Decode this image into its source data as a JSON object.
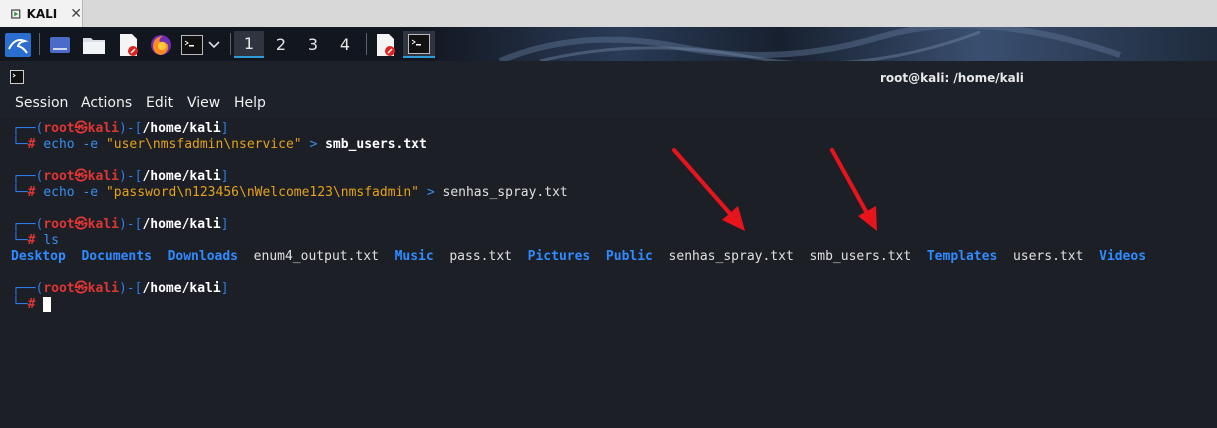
{
  "vm_tab": {
    "label": "KALI",
    "close": "✕"
  },
  "panel": {
    "workspaces": [
      "1",
      "2",
      "3",
      "4"
    ],
    "active_workspace": "1"
  },
  "window": {
    "title": "root@kali: /home/kali"
  },
  "menu": [
    "Session",
    "Actions",
    "Edit",
    "View",
    "Help"
  ],
  "prompt": {
    "open": "┌──(",
    "user": "root",
    "at": "㉿",
    "host": "kali",
    "mid": ")-[",
    "path": "/home/kali",
    "close": "]",
    "lower": "└─",
    "hash": "#"
  },
  "commands": [
    {
      "cmd": "echo",
      "flag": "-e",
      "arg": "\"user\\nmsfadmin\\nservice\"",
      "redir": ">",
      "file": "smb_users.txt"
    },
    {
      "cmd": "echo",
      "flag": "-e",
      "arg": "\"password\\n123456\\nWelcome123\\nmsfadmin\"",
      "redir": ">",
      "file": "senhas_spray.txt"
    },
    {
      "cmd": "ls"
    }
  ],
  "ls_output": [
    {
      "name": "Desktop",
      "dir": true
    },
    {
      "name": "Documents",
      "dir": true
    },
    {
      "name": "Downloads",
      "dir": true
    },
    {
      "name": "enum4_output.txt",
      "dir": false
    },
    {
      "name": "Music",
      "dir": true
    },
    {
      "name": "pass.txt",
      "dir": false
    },
    {
      "name": "Pictures",
      "dir": true
    },
    {
      "name": "Public",
      "dir": true
    },
    {
      "name": "senhas_spray.txt",
      "dir": false
    },
    {
      "name": "smb_users.txt",
      "dir": false
    },
    {
      "name": "Templates",
      "dir": true
    },
    {
      "name": "users.txt",
      "dir": false
    },
    {
      "name": "Videos",
      "dir": true
    }
  ],
  "colors": {
    "prompt_frame": "#2c7de6",
    "user_host": "#e03535",
    "directory": "#2f8bff",
    "string": "#e5a21a",
    "annotation_arrow": "#e8141b"
  },
  "icons": [
    "kali-menu-icon",
    "show-desktop-icon",
    "file-manager-icon",
    "text-editor-icon",
    "firefox-icon",
    "terminal-icon",
    "chevron-down-icon",
    "terminal-window-icon"
  ]
}
